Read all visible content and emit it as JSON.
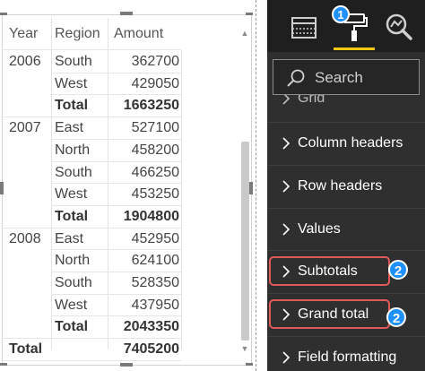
{
  "matrix": {
    "headers": {
      "year": "Year",
      "region": "Region",
      "amount": "Amount"
    },
    "rows": [
      {
        "year": "2006",
        "region": "South",
        "amount": "362700",
        "bold": false
      },
      {
        "year": "",
        "region": "West",
        "amount": "429050",
        "bold": false
      },
      {
        "year": "",
        "region": "Total",
        "amount": "1663250",
        "bold": true
      },
      {
        "year": "2007",
        "region": "East",
        "amount": "527100",
        "bold": false
      },
      {
        "year": "",
        "region": "North",
        "amount": "458200",
        "bold": false
      },
      {
        "year": "",
        "region": "South",
        "amount": "466250",
        "bold": false
      },
      {
        "year": "",
        "region": "West",
        "amount": "453250",
        "bold": false
      },
      {
        "year": "",
        "region": "Total",
        "amount": "1904800",
        "bold": true
      },
      {
        "year": "2008",
        "region": "East",
        "amount": "452950",
        "bold": false
      },
      {
        "year": "",
        "region": "North",
        "amount": "624100",
        "bold": false
      },
      {
        "year": "",
        "region": "South",
        "amount": "528350",
        "bold": false
      },
      {
        "year": "",
        "region": "West",
        "amount": "437950",
        "bold": false
      },
      {
        "year": "",
        "region": "Total",
        "amount": "2043350",
        "bold": true
      },
      {
        "year": "Total",
        "region": "",
        "amount": "7405200",
        "bold": true
      }
    ]
  },
  "pane": {
    "search_placeholder": "Search",
    "tools": [
      "fields-icon",
      "format-paint-roller-icon",
      "analytics-magnifier-icon"
    ],
    "active_tool_color": "#f2c811",
    "items": [
      {
        "label": "Grid",
        "partial": true
      },
      {
        "label": "Column headers",
        "partial": false
      },
      {
        "label": "Row headers",
        "partial": false
      },
      {
        "label": "Values",
        "partial": false
      },
      {
        "label": "Subtotals",
        "partial": false,
        "highlighted": true
      },
      {
        "label": "Grand total",
        "partial": false,
        "highlighted": true
      },
      {
        "label": "Field formatting",
        "partial": false
      }
    ]
  },
  "callouts": {
    "badge_1": "1",
    "badge_subtotals": "2",
    "badge_grand_total": "2"
  },
  "colors": {
    "badge": "#1e90ff",
    "highlight_border": "#e05a5a",
    "pane_bg": "#2f2f2f"
  }
}
